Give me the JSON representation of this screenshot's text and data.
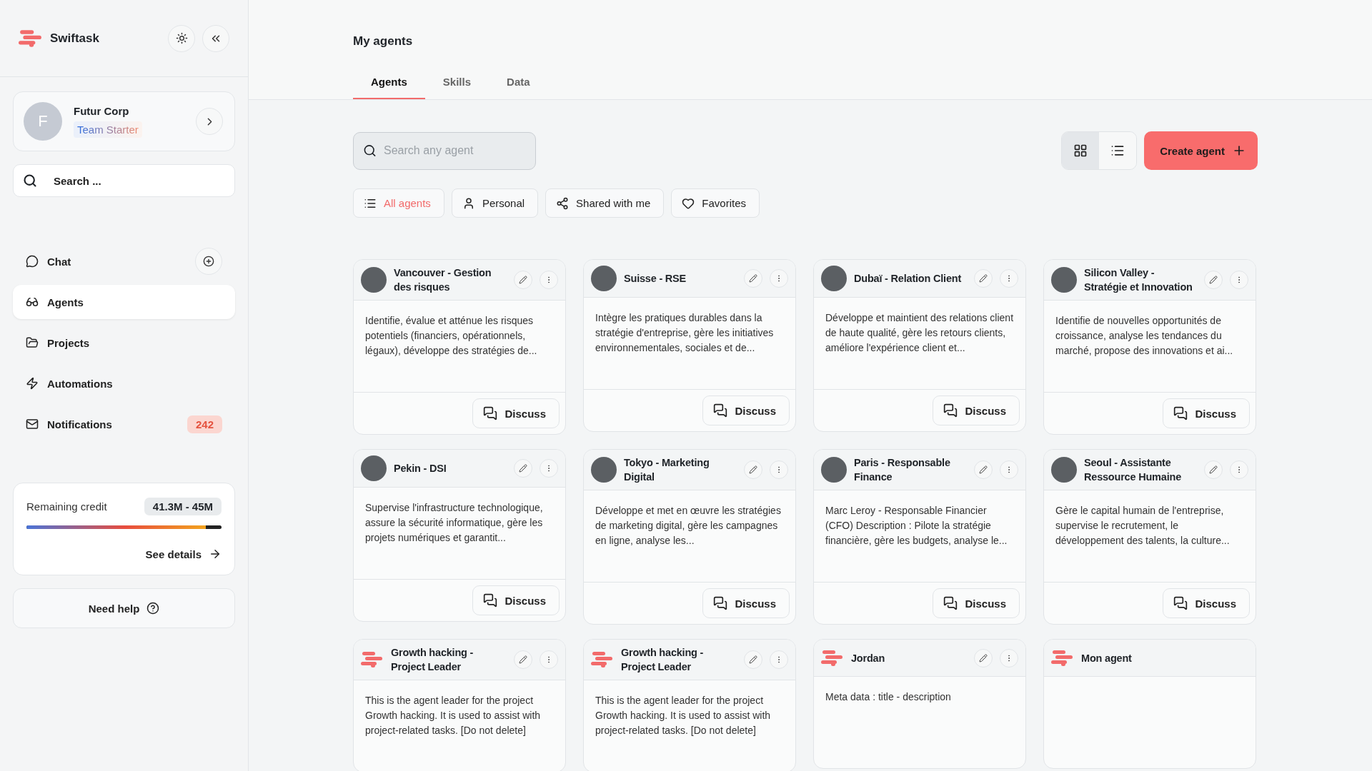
{
  "sidebar": {
    "brand": "Swiftask",
    "account": {
      "initial": "F",
      "name": "Futur Corp",
      "plan": "Team Starter"
    },
    "search": {
      "placeholder": "Search ..."
    },
    "nav": [
      {
        "label": "Chat",
        "selected": false
      },
      {
        "label": "Agents",
        "selected": true
      },
      {
        "label": "Projects",
        "selected": false
      },
      {
        "label": "Automations",
        "selected": false
      },
      {
        "label": "Notifications",
        "selected": false,
        "badge": "242"
      }
    ],
    "credit": {
      "label": "Remaining credit",
      "value": "41.3M - 45M",
      "level": 0.92,
      "link": "See details"
    },
    "help": "Need help"
  },
  "page": {
    "title": "My agents",
    "tabs": [
      {
        "label": "Agents",
        "selected": true
      },
      {
        "label": "Skills",
        "selected": false
      },
      {
        "label": "Data",
        "selected": false
      }
    ],
    "search": {
      "placeholder": "Search any agent"
    },
    "views": [
      {
        "selected": true
      },
      {
        "selected": false
      }
    ],
    "create_button": "Create agent",
    "filters": [
      {
        "label": "All agents",
        "selected": true
      },
      {
        "label": "Personal",
        "selected": false
      },
      {
        "label": "Shared with me",
        "selected": false
      },
      {
        "label": "Favorites",
        "selected": false
      }
    ],
    "agents": [
      {
        "kind": "photo",
        "name": "Vancouver - Gestion des risques",
        "description": "Identifie, évalue et atténue les risques potentiels (financiers, opérationnels, légaux), développe des stratégies de...",
        "action": "Discuss"
      },
      {
        "kind": "photo",
        "name": "Suisse - RSE",
        "description": "Intègre les pratiques durables dans la stratégie d'entreprise, gère les initiatives environnementales, sociales et de...",
        "action": "Discuss"
      },
      {
        "kind": "photo",
        "name": "Dubaï - Relation Client",
        "description": "Développe et maintient des relations client de haute qualité, gère les retours clients, améliore l'expérience client et...",
        "action": "Discuss"
      },
      {
        "kind": "photo",
        "name": "Silicon Valley - Stratégie et Innovation",
        "description": "Identifie de nouvelles opportunités de croissance, analyse les tendances du marché, propose des innovations et ai...",
        "action": "Discuss"
      },
      {
        "kind": "photo",
        "name": "Pekin - DSI",
        "description": "Supervise l'infrastructure technologique, assure la sécurité informatique, gère les projets numériques et garantit...",
        "action": "Discuss"
      },
      {
        "kind": "photo",
        "name": "Tokyo - Marketing Digital",
        "description": "Développe et met en œuvre les stratégies de marketing digital, gère les campagnes en ligne, analyse les...",
        "action": "Discuss"
      },
      {
        "kind": "photo",
        "name": "Paris - Responsable Finance",
        "description": "Marc Leroy - Responsable Financier (CFO) Description : Pilote la stratégie financière, gère les budgets, analyse le...",
        "action": "Discuss"
      },
      {
        "kind": "photo",
        "name": "Seoul - Assistante Ressource Humaine",
        "description": "Gère le capital humain de l'entreprise, supervise le recrutement, le développement des talents, la culture...",
        "action": "Discuss"
      },
      {
        "kind": "logo",
        "name": "Growth hacking - Project Leader",
        "description": "This is the agent leader for the project Growth hacking. It is used to assist with project-related tasks. [Do not delete]"
      },
      {
        "kind": "logo",
        "name": "Growth hacking - Project Leader",
        "description": "This is the agent leader for the project Growth hacking. It is used to assist with project-related tasks. [Do not delete]"
      },
      {
        "kind": "logo",
        "name": "Jordan",
        "description": "Meta data : title - description"
      },
      {
        "kind": "logo-only",
        "name": "Mon agent"
      }
    ]
  }
}
